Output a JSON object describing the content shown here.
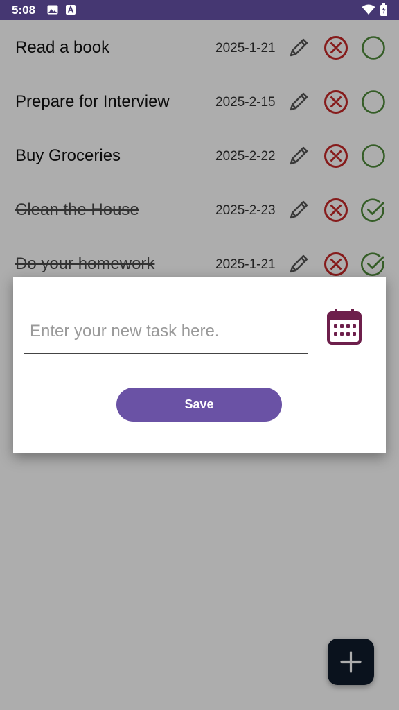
{
  "status_bar": {
    "time": "5:08",
    "icons": [
      "image-icon",
      "a-icon",
      "wifi-icon",
      "battery-icon"
    ]
  },
  "tasks": [
    {
      "title": "Read a book",
      "date": "2025-1-21",
      "completed": false
    },
    {
      "title": "Prepare for Interview",
      "date": "2025-2-15",
      "completed": false
    },
    {
      "title": "Buy Groceries",
      "date": "2025-2-22",
      "completed": false
    },
    {
      "title": "Clean the House",
      "date": "2025-2-23",
      "completed": true
    },
    {
      "title": "Do your homework",
      "date": "2025-1-21",
      "completed": true
    }
  ],
  "dialog": {
    "input_placeholder": "Enter your new task here.",
    "input_value": "",
    "save_label": "Save"
  },
  "colors": {
    "status_bar": "#453772",
    "delete": "#c62828",
    "complete": "#4e8a3a",
    "calendar": "#6d1f4b",
    "save_button": "#6a52a5",
    "fab": "#0f1b2b"
  }
}
